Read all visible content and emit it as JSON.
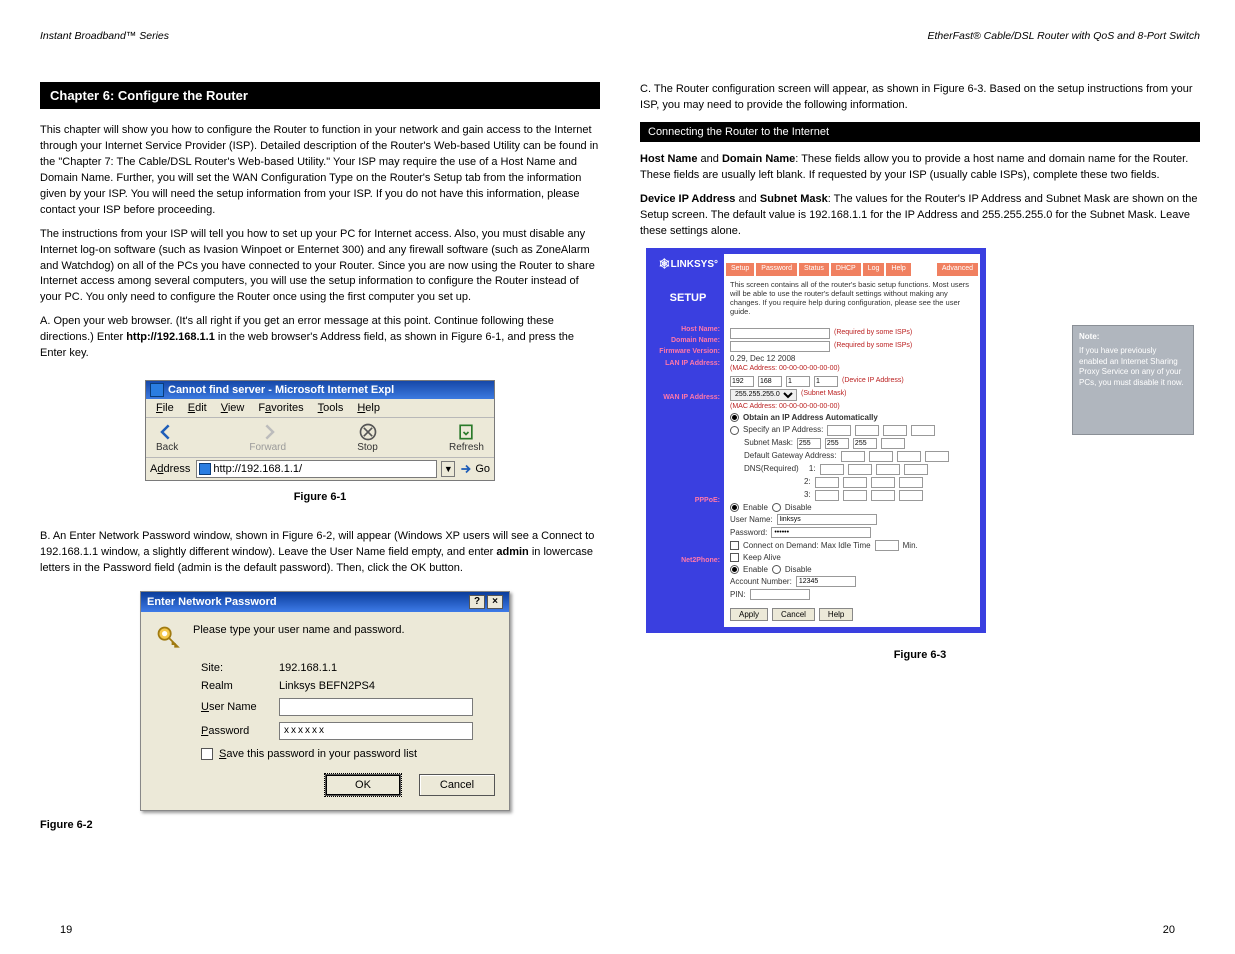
{
  "headers": {
    "left": "Instant Broadband™ Series",
    "right": "EtherFast® Cable/DSL Router with QoS and 8-Port Switch"
  },
  "chapterTitle": "Chapter 6: Configure the Router",
  "sectionHeading": "Connecting the Router to the Internet",
  "left": {
    "intro": "This chapter will show you how to configure the Router to function in your network and gain access to the Internet through your Internet Service Provider (ISP). Detailed description of the Router's Web-based Utility can be found in the \"Chapter 7: The Cable/DSL Router's Web-based Utility.\" Your ISP may require the use of a Host Name and Domain Name. Further, you will set the WAN Configuration Type on the Router's Setup tab from the information given by your ISP. You will need the setup information from your ISP. If you do not have this information, please contact your ISP before proceeding.",
    "instructions": "The instructions from your ISP will tell you how to set up your PC for Internet access. Also, you must disable any Internet log-on software (such as Ivasion Winpoet or Enternet 300) and any firewall software (such as ZoneAlarm and Watchdog) on all of the PCs you have connected to your Router. Since you are now using the Router to share Internet access among several computers, you will use the setup information to configure the Router instead of your PC. You only need to configure the Router once using the first computer you set up.",
    "stepA_pre": "A. Open your web browser. (It's all right if you get an error message at this point. Continue following these directions.) Enter ",
    "stepA_bold": "http://192.168.1.1",
    "stepA_post": " in the web browser's Address field, as shown in Figure 6-1, and press the Enter key.",
    "fig61_caption": "Figure 6-1",
    "stepB_pre": "B. An Enter Network Password window, shown in Figure 6-2, will appear (Windows XP users will see a Connect to 192.168.1.1 window, a slightly different window). Leave the User Name field empty, and enter ",
    "stepB_bold": "admin",
    "stepB_post": " in lowercase letters in the Password field (admin is the default password). Then, click the OK button."
  },
  "ie": {
    "title": "Cannot find server - Microsoft Internet Expl",
    "menu": {
      "file": "File",
      "edit": "Edit",
      "view": "View",
      "favorites": "Favorites",
      "tools": "Tools",
      "help": "Help"
    },
    "back": "Back",
    "forward": "Forward",
    "stop": "Stop",
    "refresh": "Refresh",
    "addressLabel": "Address",
    "url": "http://192.168.1.1/",
    "go": "Go"
  },
  "pwd": {
    "title": "Enter Network Password",
    "intro": "Please type your user name and password.",
    "siteLabel": "Site:",
    "site": "192.168.1.1",
    "realmLabel": "Realm",
    "realm": "Linksys BEFN2PS4",
    "userLabel": "User Name",
    "user": "",
    "passLabel": "Password",
    "pass": "xxxxxx",
    "save": "Save this password in your password list",
    "ok": "OK",
    "cancel": "Cancel",
    "caption": "Figure 6-2"
  },
  "right": {
    "stepC": "C. The Router configuration screen will appear, as shown in Figure 6-3. Based on the setup instructions from your ISP, you may need to provide the following information.",
    "hostDomain_pre": "Host Name",
    "hostDomain_mid": " and ",
    "hostDomain_bold2": "Domain Name",
    "hostDomain_post": ": These fields allow you to provide a host name and domain name for the Router. These fields are usually left blank. If requested by your ISP (usually cable ISPs), complete these two fields.",
    "devIP_bold": "Device IP Address",
    "devIP_mid": " and ",
    "devIP_bold2": "Subnet Mask",
    "devIP_post": ": The values for the Router's IP Address and Subnet Mask are shown on the Setup screen. The default value is 192.168.1.1 for the IP Address and 255.255.255.0 for the Subnet Mask. Leave these settings alone.",
    "fig63_caption": "Figure 6-3"
  },
  "setup": {
    "brand": "LINKSYS",
    "tabs": [
      "Setup",
      "Password",
      "Status",
      "DHCP",
      "Log",
      "Help"
    ],
    "tabRight": "Advanced",
    "label": "SETUP",
    "desc": "This screen contains all of the router's basic setup functions. Most users will be able to use the router's default settings without making any changes. If you require help during configuration, please see the user guide.",
    "side": [
      "Host Name:",
      "Domain Name:",
      "Firmware Version:",
      "LAN IP Address:",
      "WAN IP Address:",
      "PPPoE:",
      "Net2Phone:"
    ],
    "hostHint": "(Required by some ISPs)",
    "domainHint": "(Required by some ISPs)",
    "firmware": "0.29, Dec 12 2008",
    "machineAddr": "(MAC Address: 00-00-00-00-00-00)",
    "lanIp": [
      "192",
      "168",
      "1",
      "1"
    ],
    "lanIpLabel": "(Device IP Address)",
    "subnet": "255.255.255.0",
    "subnetLabel": "(Subnet Mask)",
    "wanOpt1": "Obtain an IP Address Automatically",
    "wanOpt2": "Specify an IP Address:",
    "subnetMaskLabel": "Subnet Mask:",
    "gatewayLabel": "Default Gateway Address:",
    "dnsLabel": "DNS(Required)",
    "dns1": "1:",
    "dns2": "2:",
    "dns3": "3:",
    "enable": "Enable",
    "disable": "Disable",
    "userNameLabel": "User Name:",
    "userNameVal": "linksys",
    "passwordLabel": "Password:",
    "passwordVal": "••••••",
    "connectDemand": "Connect on Demand: Max Idle Time",
    "min": "Min.",
    "keepAlive": "Keep Alive",
    "acctLabel": "Account Number:",
    "acctVal": "12345",
    "pinLabel": "PIN:",
    "apply": "Apply",
    "cancelBtn": "Cancel",
    "help": "Help"
  },
  "sideNote": {
    "hd": "Note:",
    "body": "If you have previously enabled an Internet Sharing Proxy Service on any of your PCs, you must disable it now."
  },
  "pageLeft": "19",
  "pageRight": "20"
}
